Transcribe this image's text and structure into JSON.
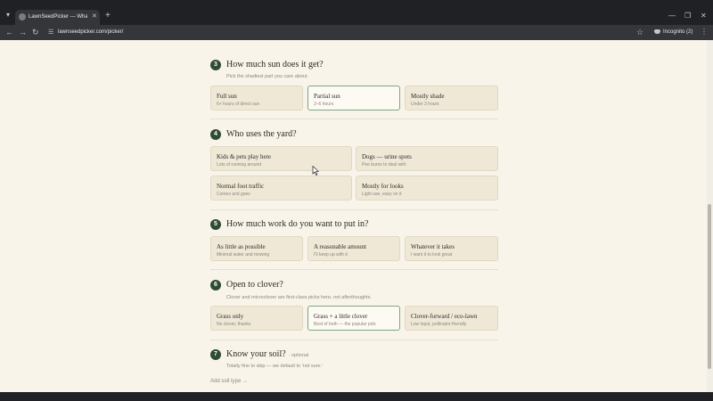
{
  "browser": {
    "tab_title": "LawnSeedPicker — What should",
    "url": "lawnseedpicker.com/picker/",
    "incognito_label": "Incognito (2)"
  },
  "questions": [
    {
      "number": "3",
      "title": "How much sun does it get?",
      "subtitle": "Pick the shadiest part you care about.",
      "options": [
        {
          "title": "Full sun",
          "sub": "6+ hours of direct sun",
          "selected": false
        },
        {
          "title": "Partial sun",
          "sub": "3–6 hours",
          "selected": true
        },
        {
          "title": "Mostly shade",
          "sub": "Under 3 hours",
          "selected": false
        }
      ]
    },
    {
      "number": "4",
      "title": "Who uses the yard?",
      "options": [
        {
          "title": "Kids & pets play here",
          "sub": "Lots of running around",
          "selected": false
        },
        {
          "title": "Dogs — urine spots",
          "sub": "Pee burns to deal with",
          "selected": false
        },
        {
          "title": "Normal foot traffic",
          "sub": "Comes and goes",
          "selected": false
        },
        {
          "title": "Mostly for looks",
          "sub": "Light use, easy on it",
          "selected": false
        }
      ]
    },
    {
      "number": "5",
      "title": "How much work do you want to put in?",
      "options": [
        {
          "title": "As little as possible",
          "sub": "Minimal water and mowing",
          "selected": false
        },
        {
          "title": "A reasonable amount",
          "sub": "I'll keep up with it",
          "selected": false
        },
        {
          "title": "Whatever it takes",
          "sub": "I want it to look great",
          "selected": false
        }
      ]
    },
    {
      "number": "6",
      "title": "Open to clover?",
      "subtitle": "Clover and microclover are first-class picks here, not afterthoughts.",
      "options": [
        {
          "title": "Grass only",
          "sub": "No clover, thanks",
          "selected": false
        },
        {
          "title": "Grass + a little clover",
          "sub": "Best of both — the popular pick",
          "selected": true
        },
        {
          "title": "Clover-forward / eco-lawn",
          "sub": "Low input, pollinator-friendly",
          "selected": false
        }
      ]
    },
    {
      "number": "7",
      "title": "Know your soil?",
      "optional_label": "· optional",
      "subtitle": "Totally fine to skip — we default to 'not sure.'",
      "link_label": "Add soil type →"
    }
  ],
  "icons": {
    "tab_search": "chevron-down-icon",
    "favicon": "globe-icon",
    "close": "close-icon",
    "new_tab": "plus-icon",
    "back": "arrow-left-icon",
    "forward": "arrow-right-icon",
    "reload": "reload-icon",
    "site_info": "tune-icon",
    "bookmark": "star-icon",
    "incognito": "incognito-icon",
    "menu": "kebab-menu-icon",
    "cursor": "mouse-pointer-icon"
  },
  "colors": {
    "page_bg": "#f8f4ea",
    "card_bg": "#efe8d6",
    "selected_border": "#7da683",
    "number_badge": "#2f4a35",
    "chrome_dark": "#202124"
  }
}
